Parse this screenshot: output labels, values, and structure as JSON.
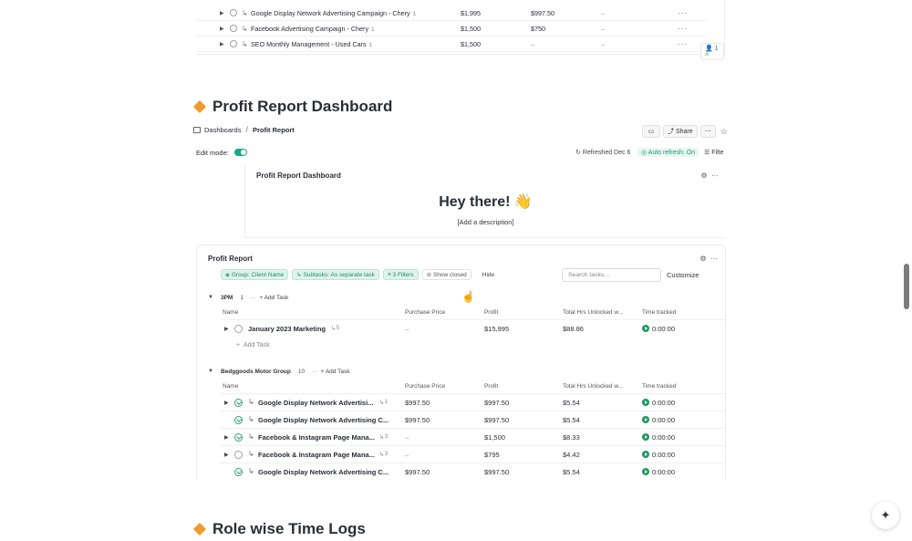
{
  "top_table": {
    "rows": [
      {
        "name": "Google Display Network Advertising Campaign - Chery",
        "count": "1",
        "c1": "$1,995",
        "c2": "$997.50",
        "c3": "–"
      },
      {
        "name": "Facebook Advertising Campaign - Chery",
        "count": "1",
        "c1": "$1,500",
        "c2": "$750",
        "c3": "–"
      },
      {
        "name": "SEO Monthly Management - Used Cars",
        "count": "1",
        "c1": "$1,500",
        "c2": "–",
        "c3": "–"
      }
    ],
    "badge": "1"
  },
  "section1": {
    "title": "Profit Report Dashboard"
  },
  "breadcrumb": {
    "root": "Dashboards",
    "sep": "/",
    "current": "Profit Report"
  },
  "toolbar": {
    "share": "Share",
    "more": "⋯",
    "star": "☆"
  },
  "editrow": {
    "label": "Edit mode:",
    "refreshed": "Refreshed Dec 6",
    "auto_refresh": "Auto refresh: On",
    "filter": "Filte"
  },
  "card1": {
    "title": "Profit Report Dashboard",
    "greeting": "Hey there! 👋",
    "description": "[Add a description]"
  },
  "card2": {
    "title": "Profit Report",
    "chips": {
      "group": "Group: Client Name",
      "subtasks": "Subtasks: As separate task",
      "filters": "3 Filters",
      "show_closed": "Show closed",
      "hide": "Hide"
    },
    "search_placeholder": "Search tasks...",
    "customize": "Customize",
    "columns": {
      "name": "Name",
      "purchase": "Purchase Price",
      "profit": "Profit",
      "hours": "Total Hrs Unlocked w...",
      "time": "Time tracked"
    },
    "groups": [
      {
        "name": "3PM",
        "count": "1",
        "add": "Add Task",
        "rows": [
          {
            "name": "January 2023 Marketing",
            "count": "5",
            "purchase": "–",
            "profit": "$15,995",
            "hours": "$88.86",
            "time": "0:00:00"
          }
        ],
        "add_row": "Add Task"
      },
      {
        "name": "Bedggoods Motor Group",
        "count": "10",
        "add": "Add Task",
        "rows": [
          {
            "name": "Google Display Network Advertisi...",
            "count": "1",
            "purchase": "$997.50",
            "profit": "$997.50",
            "hours": "$5.54",
            "time": "0:00:00"
          },
          {
            "name": "Google Display Network Advertising C...",
            "count": "",
            "purchase": "$997.50",
            "profit": "$997.50",
            "hours": "$5.54",
            "time": "0:00:00"
          },
          {
            "name": "Facebook & Instagram Page Mana...",
            "count": "3",
            "purchase": "–",
            "profit": "$1,500",
            "hours": "$8.33",
            "time": "0:00:00"
          },
          {
            "name": "Facebook & Instagram Page Mana...",
            "count": "3",
            "purchase": "–",
            "profit": "$795",
            "hours": "$4.42",
            "time": "0:00:00"
          },
          {
            "name": "Google Display Network Advertising C...",
            "count": "",
            "purchase": "$997.50",
            "profit": "$997.50",
            "hours": "$5.54",
            "time": "0:00:00"
          }
        ]
      }
    ]
  },
  "section2": {
    "title": "Role wise Time Logs"
  },
  "icons": {
    "ai": "✦",
    "gear": "⚙",
    "dots": "⋯",
    "cursor": "pointer-hand"
  }
}
